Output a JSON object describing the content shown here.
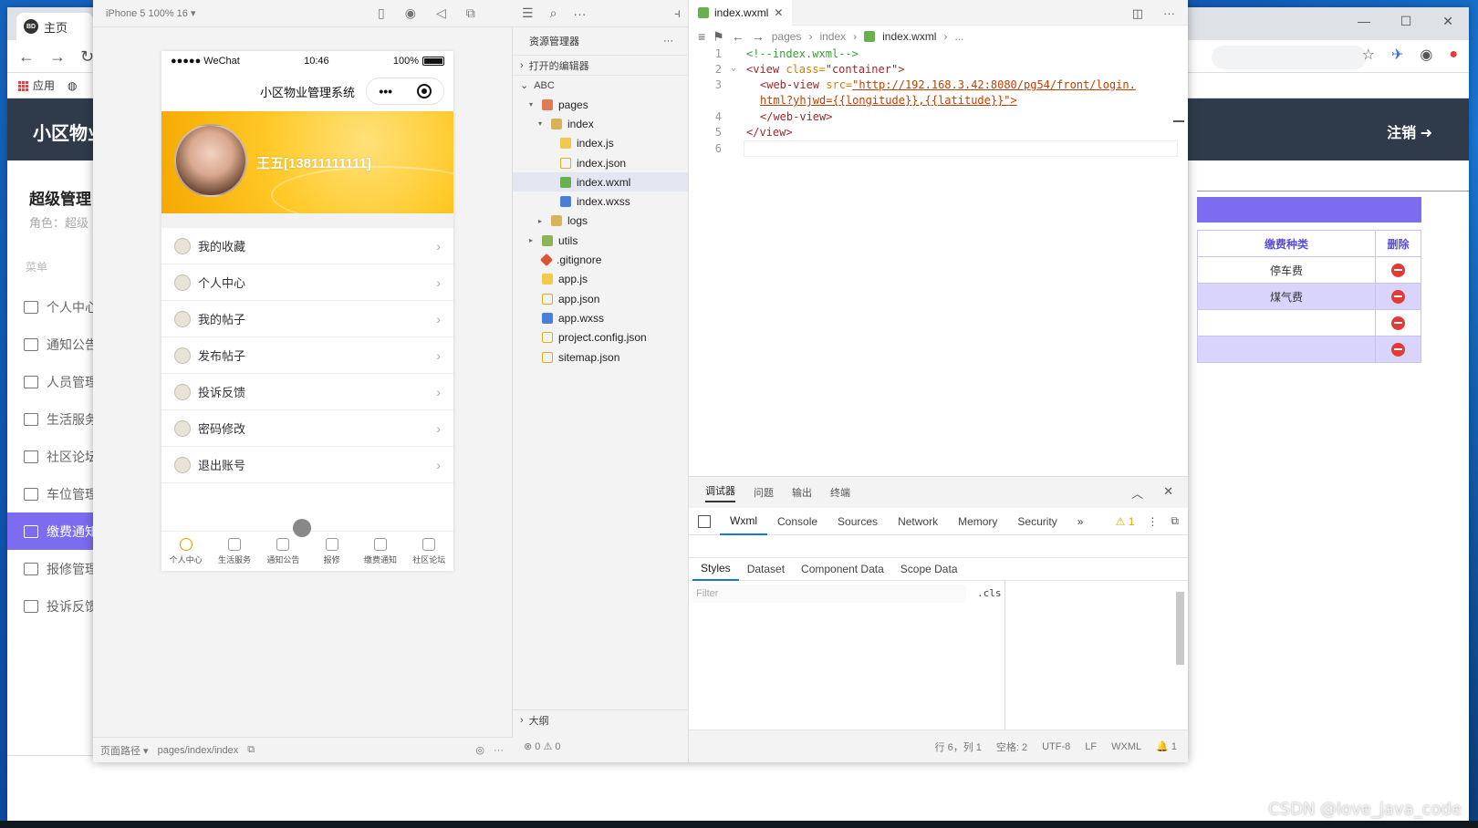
{
  "browser": {
    "tab_title": "主页",
    "favicon_text": "BD",
    "bookmarks": [
      {
        "label": "应用"
      }
    ],
    "win_controls": [
      "—",
      "☐",
      "✕"
    ]
  },
  "admin": {
    "header_title": "小区物业",
    "logout_label": "注销",
    "user_name": "超级管理",
    "role_label": "角色：超级",
    "menu_heading": "菜单",
    "menu": [
      {
        "label": "个人中心"
      },
      {
        "label": "通知公告"
      },
      {
        "label": "人员管理"
      },
      {
        "label": "生活服务"
      },
      {
        "label": "社区论坛"
      },
      {
        "label": "车位管理"
      },
      {
        "label": "缴费通知",
        "active": true
      },
      {
        "label": "报修管理"
      },
      {
        "label": "投诉反馈"
      }
    ],
    "fee_table": {
      "headers": [
        "缴费种类",
        "删除"
      ],
      "rows": [
        [
          "停车费"
        ],
        [
          "煤气费"
        ],
        [
          ""
        ],
        [
          ""
        ]
      ]
    }
  },
  "simulator": {
    "device": "iPhone 5 100% 16 ▾",
    "status": {
      "carrier": "●●●●● WeChat",
      "time": "10:46",
      "battery": "100%"
    },
    "nav_title": "小区物业管理系统",
    "capsule_dots": "•••",
    "user_display": "王五[13811111111]",
    "menu": [
      {
        "label": "我的收藏"
      },
      {
        "label": "个人中心"
      },
      {
        "label": "我的帖子"
      },
      {
        "label": "发布帖子"
      },
      {
        "label": "投诉反馈"
      },
      {
        "label": "密码修改"
      },
      {
        "label": "退出账号"
      }
    ],
    "tabbar": [
      {
        "label": "个人中心"
      },
      {
        "label": "生活服务"
      },
      {
        "label": "通知公告"
      },
      {
        "label": "报修"
      },
      {
        "label": "缴费通知"
      },
      {
        "label": "社区论坛"
      }
    ],
    "footer_path_label": "页面路径 ▾",
    "footer_path": "pages/index/index"
  },
  "explorer": {
    "title": "资源管理器",
    "open_editors": "打开的编辑器",
    "project": "ABC",
    "tree": [
      {
        "label": "pages",
        "depth": 1,
        "type": "folder-red",
        "twisty": "▾"
      },
      {
        "label": "index",
        "depth": 2,
        "type": "folder",
        "twisty": "▾"
      },
      {
        "label": "index.js",
        "depth": 3,
        "type": "js",
        "twisty": ""
      },
      {
        "label": "index.json",
        "depth": 3,
        "type": "json",
        "twisty": ""
      },
      {
        "label": "index.wxml",
        "depth": 3,
        "type": "wxml",
        "twisty": "",
        "selected": true
      },
      {
        "label": "index.wxss",
        "depth": 3,
        "type": "wxss",
        "twisty": ""
      },
      {
        "label": "logs",
        "depth": 2,
        "type": "folder",
        "twisty": "▸"
      },
      {
        "label": "utils",
        "depth": 1,
        "type": "folder-green",
        "twisty": "▸"
      },
      {
        "label": ".gitignore",
        "depth": 1,
        "type": "git",
        "twisty": ""
      },
      {
        "label": "app.js",
        "depth": 1,
        "type": "js",
        "twisty": ""
      },
      {
        "label": "app.json",
        "depth": 1,
        "type": "json",
        "twisty": ""
      },
      {
        "label": "app.wxss",
        "depth": 1,
        "type": "wxss",
        "twisty": ""
      },
      {
        "label": "project.config.json",
        "depth": 1,
        "type": "json",
        "twisty": ""
      },
      {
        "label": "sitemap.json",
        "depth": 1,
        "type": "json",
        "twisty": ""
      }
    ],
    "outline": "大纲",
    "problems": "⊗ 0 ⚠ 0"
  },
  "editor": {
    "tab": "index.wxml",
    "breadcrumb": [
      "pages",
      "index",
      "index.wxml",
      "..."
    ],
    "line_numbers": [
      "1",
      "2",
      "3",
      "",
      "4",
      "5",
      "6"
    ],
    "lines": {
      "l1": "<!--index.wxml-->",
      "l2_tag": "<view ",
      "l2_attr": "class=",
      "l2_val": "\"container\">",
      "l3_tag": "<web-view ",
      "l3_attr": "src=",
      "l3_val": "\"http://192.168.3.42:8080/pg54/front/login.",
      "l3b_val": "html?yhjwd={{longitude}},{{latitude}}\">",
      "l4": "</web-view>",
      "l5": "</view>"
    }
  },
  "debugger": {
    "top_tabs": [
      "调试器",
      "问题",
      "输出",
      "终端"
    ],
    "dt_tabs": [
      "Wxml",
      "Console",
      "Sources",
      "Network",
      "Memory",
      "Security",
      "»"
    ],
    "warn_count": "1",
    "sub_tabs": [
      "Styles",
      "Dataset",
      "Component Data",
      "Scope Data"
    ],
    "filter_placeholder": "Filter",
    "cls": ".cls"
  },
  "status_bar": [
    "行 6，列 1",
    "空格: 2",
    "UTF-8",
    "LF",
    "WXML",
    "🔔 1"
  ],
  "watermark": "CSDN @love_java_code"
}
